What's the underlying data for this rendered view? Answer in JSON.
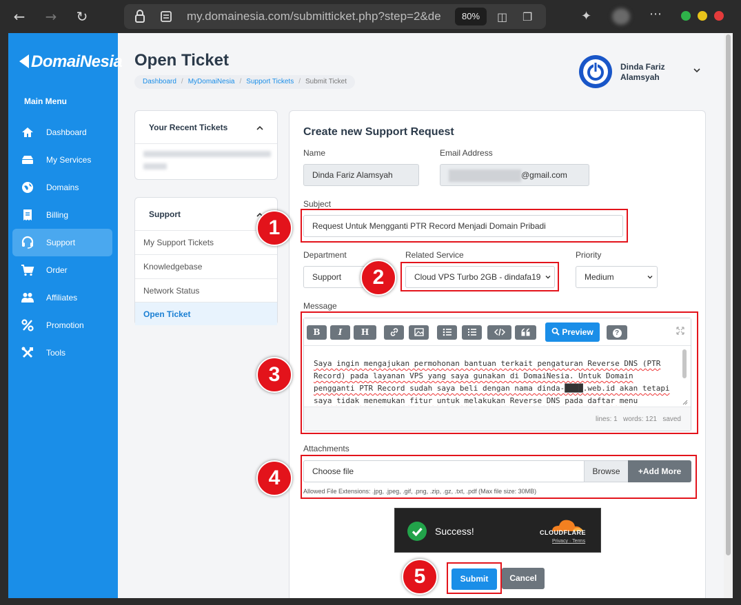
{
  "browser": {
    "url": "my.domainesia.com/submitticket.php?step=2&de",
    "zoom": "80%"
  },
  "sidebar": {
    "logo": "DomaiNesia",
    "menu_title": "Main Menu",
    "items": [
      {
        "label": "Dashboard",
        "icon": "home-icon"
      },
      {
        "label": "My Services",
        "icon": "server-icon"
      },
      {
        "label": "Domains",
        "icon": "globe-icon"
      },
      {
        "label": "Billing",
        "icon": "receipt-icon"
      },
      {
        "label": "Support",
        "icon": "headset-icon",
        "active": true
      },
      {
        "label": "Order",
        "icon": "cart-icon"
      },
      {
        "label": "Affiliates",
        "icon": "people-icon"
      },
      {
        "label": "Promotion",
        "icon": "percent-icon"
      },
      {
        "label": "Tools",
        "icon": "tools-icon"
      }
    ]
  },
  "header": {
    "title": "Open Ticket",
    "breadcrumb": [
      "Dashboard",
      "MyDomaiNesia",
      "Support Tickets",
      "Submit Ticket"
    ],
    "user": {
      "line1": "Dinda Fariz",
      "line2": "Alamsyah"
    }
  },
  "recent_tickets": {
    "title": "Your Recent Tickets"
  },
  "support_card": {
    "title": "Support",
    "links": [
      "My Support Tickets",
      "Knowledgebase",
      "Network Status",
      "Open Ticket"
    ]
  },
  "form": {
    "title": "Create new Support Request",
    "name_label": "Name",
    "name_value": "Dinda Fariz Alamsyah",
    "email_label": "Email Address",
    "email_value": "@gmail.com",
    "subject_label": "Subject",
    "subject_value": "Request Untuk Mengganti  PTR Record  Menjadi Domain Pribadi",
    "department_label": "Department",
    "department_value": "Support",
    "service_label": "Related Service",
    "service_value": "Cloud VPS Turbo 2GB - dindafa19",
    "priority_label": "Priority",
    "priority_value": "Medium",
    "message_label": "Message",
    "toolbar": {
      "bold": "B",
      "italic": "I",
      "heading": "H",
      "preview": "Preview",
      "help": "?"
    },
    "message_text": "Saya ingin mengajukan permohonan bantuan terkait pengaturan Reverse DNS (PTR Record) pada layanan VPS yang saya gunakan di DomaiNesia. Untuk Domain pengganti PTR Record sudah saya beli dengan nama dinda-████.web.id akan tetapi saya tidak menemukan fitur untuk melakukan Reverse DNS pada daftar menu",
    "status": {
      "lines": "lines: 1",
      "words": "words: 121",
      "saved": "saved"
    },
    "attachments_label": "Attachments",
    "file_placeholder": "Choose file",
    "browse": "Browse",
    "add_more": "+Add More",
    "file_hint": "Allowed File Extensions: .jpg, .jpeg, .gif, .png, .zip, .gz, .txt, .pdf (Max file size: 30MB)",
    "captcha": {
      "status": "Success!",
      "brand": "CLOUDFLARE",
      "privacy": "Privacy",
      "terms": "Terms"
    },
    "submit": "Submit",
    "cancel": "Cancel"
  },
  "annotations": [
    "1",
    "2",
    "3",
    "4",
    "5"
  ],
  "colors": {
    "accent": "#1a8ee8",
    "sidebar": "#1a8ee8",
    "highlight": "#e3131b",
    "secondary": "#6c757d"
  }
}
